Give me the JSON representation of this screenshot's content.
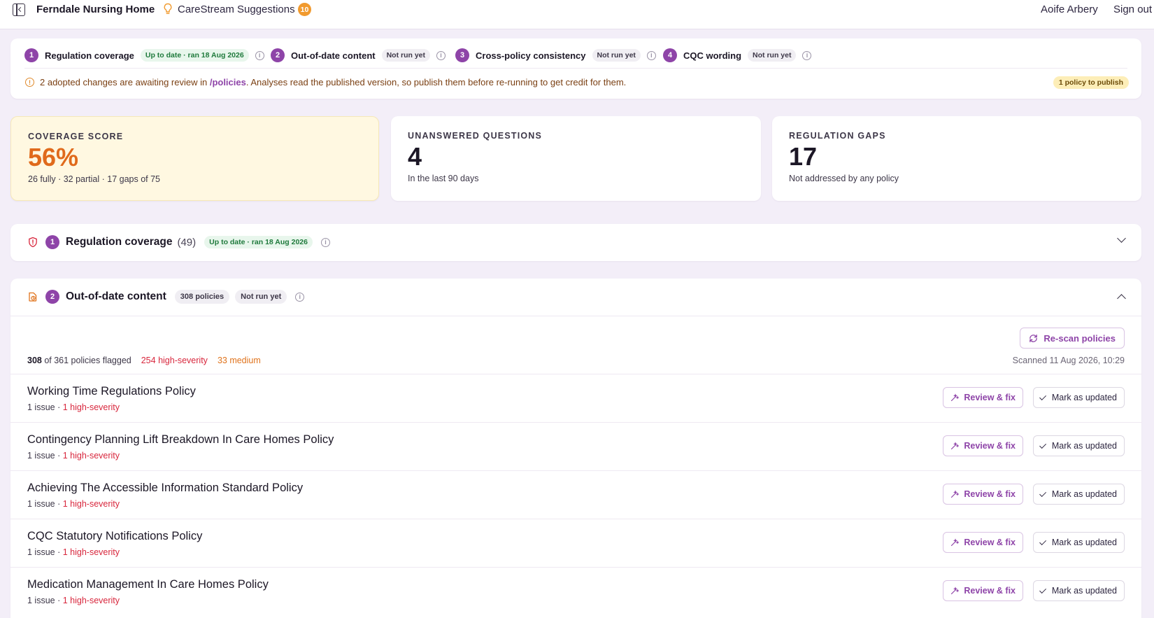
{
  "header": {
    "org_name": "Ferndale Nursing Home",
    "suggestions_label": "CareStream Suggestions",
    "suggestions_count": "10",
    "user_name": "Aoife Arbery",
    "sign_out": "Sign out"
  },
  "steps": [
    {
      "num": "1",
      "label": "Regulation coverage",
      "status": "Up to date · ran 18 Aug 2026",
      "status_type": "green"
    },
    {
      "num": "2",
      "label": "Out-of-date content",
      "status": "Not run yet",
      "status_type": "grey"
    },
    {
      "num": "3",
      "label": "Cross-policy consistency",
      "status": "Not run yet",
      "status_type": "grey"
    },
    {
      "num": "4",
      "label": "CQC wording",
      "status": "Not run yet",
      "status_type": "grey"
    }
  ],
  "notice": {
    "text_before": "2 adopted changes are awaiting review in ",
    "link": "/policies",
    "text_after": ". Analyses read the published version, so publish them before re-running to get credit for them.",
    "badge": "1 policy to publish"
  },
  "metrics": [
    {
      "label": "Coverage score",
      "value": "56%",
      "sub": "26 fully · 32 partial · 17 gaps of 75"
    },
    {
      "label": "Unanswered questions",
      "value": "4",
      "sub": "In the last 90 days"
    },
    {
      "label": "Regulation gaps",
      "value": "17",
      "sub": "Not addressed by any policy"
    }
  ],
  "regulation_section": {
    "num": "1",
    "title": "Regulation coverage",
    "count": "(49)",
    "status": "Up to date · ran 18 Aug 2026"
  },
  "outdated_section": {
    "num": "2",
    "title": "Out-of-date content",
    "policies_pill": "308 policies",
    "status": "Not run yet",
    "rescan_label": "Re-scan policies",
    "summary_flagged": "308",
    "summary_rest": " of 361 policies flagged",
    "summary_high": "254 high-severity",
    "summary_medium": "33 medium",
    "scanned": "Scanned 11 Aug 2026, 10:29",
    "review_label": "Review & fix",
    "mark_label": "Mark as updated",
    "rows": [
      {
        "title": "Working Time Regulations Policy",
        "issues": "1 issue · ",
        "severity": "1 high-severity"
      },
      {
        "title": "Contingency Planning Lift Breakdown In Care Homes Policy",
        "issues": "1 issue · ",
        "severity": "1 high-severity"
      },
      {
        "title": "Achieving The Accessible Information Standard Policy",
        "issues": "1 issue · ",
        "severity": "1 high-severity"
      },
      {
        "title": "CQC Statutory Notifications Policy",
        "issues": "1 issue · ",
        "severity": "1 high-severity"
      },
      {
        "title": "Medication Management In Care Homes Policy",
        "issues": "1 issue · ",
        "severity": "1 high-severity"
      }
    ]
  },
  "colors": {
    "accent": "#8e44a8",
    "coverage_orange": "#e06a1b",
    "high_severity": "#d8273d",
    "medium": "#e0731c",
    "highlight_bg": "#fff8e1"
  }
}
